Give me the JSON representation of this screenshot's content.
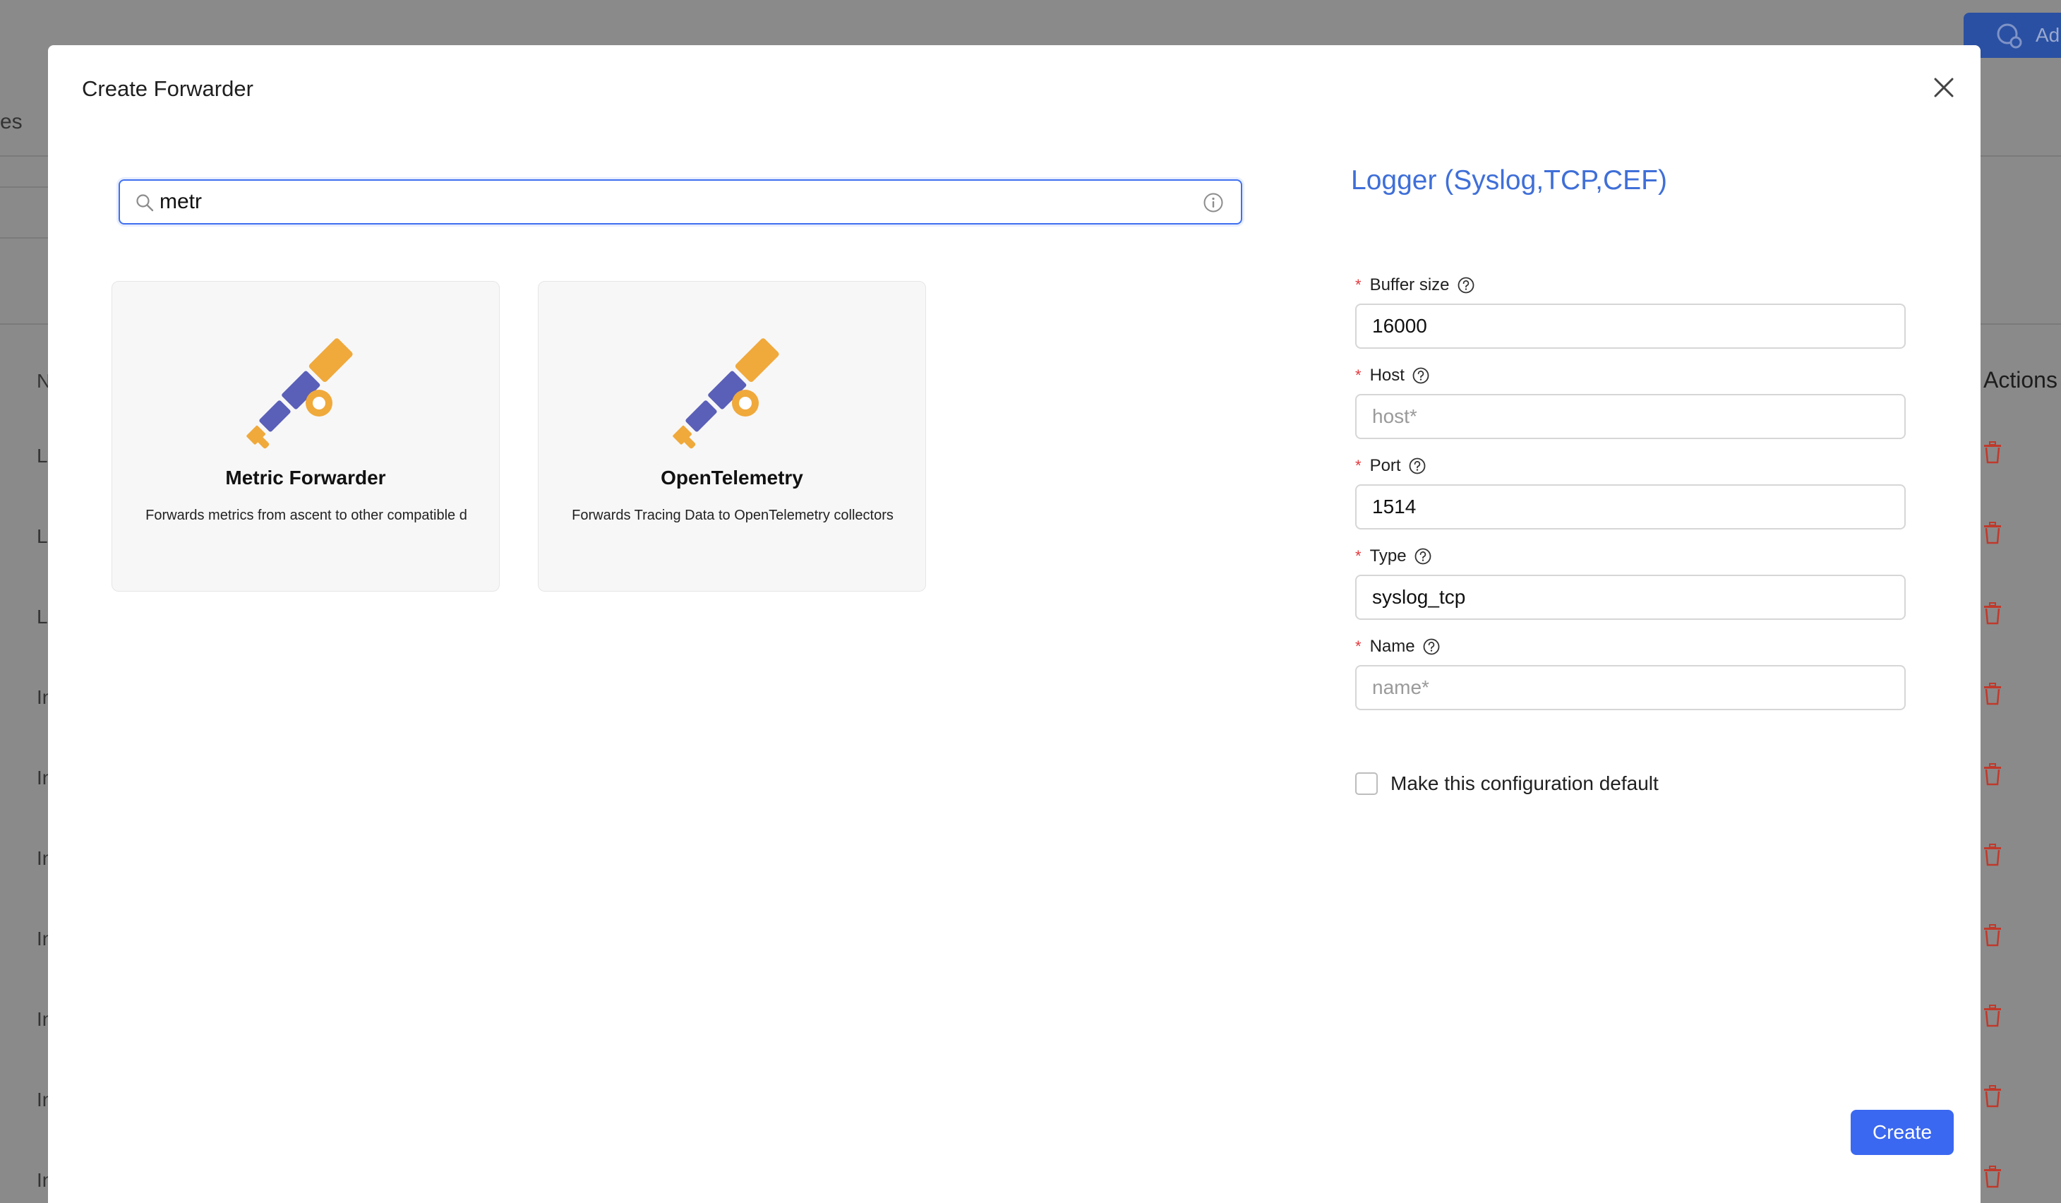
{
  "background": {
    "top_button_label": "Ad",
    "left_fragment": "es",
    "actions_header": "Actions",
    "row_labels": [
      "N",
      "L",
      "L",
      "L",
      "In",
      "In",
      "In",
      "In",
      "In",
      "In",
      "In"
    ]
  },
  "modal": {
    "title": "Create Forwarder",
    "search": {
      "value": "metr",
      "placeholder": ""
    },
    "cards": [
      {
        "title": "Metric Forwarder",
        "description": "Forwards metrics from ascent to other compatible d",
        "icon": "telescope-icon"
      },
      {
        "title": "OpenTelemetry",
        "description": "Forwards Tracing Data to OpenTelemetry collectors",
        "icon": "telescope-icon"
      }
    ],
    "form": {
      "heading": "Logger (Syslog,TCP,CEF)",
      "fields": [
        {
          "label": "Buffer size",
          "value": "16000",
          "placeholder": ""
        },
        {
          "label": "Host",
          "value": "",
          "placeholder": "host*"
        },
        {
          "label": "Port",
          "value": "1514",
          "placeholder": ""
        },
        {
          "label": "Type",
          "value": "syslog_tcp",
          "placeholder": ""
        },
        {
          "label": "Name",
          "value": "",
          "placeholder": "name*"
        }
      ],
      "required_marker": "*",
      "default_checkbox_label": "Make this configuration default",
      "default_checked": false
    },
    "create_label": "Create"
  },
  "colors": {
    "accent": "#3b68f0",
    "heading": "#3f6fd8",
    "required": "#e0393e",
    "telescope_blue": "#5a5fb8",
    "telescope_orange": "#f0a93b",
    "trash_red": "#c0392b"
  }
}
